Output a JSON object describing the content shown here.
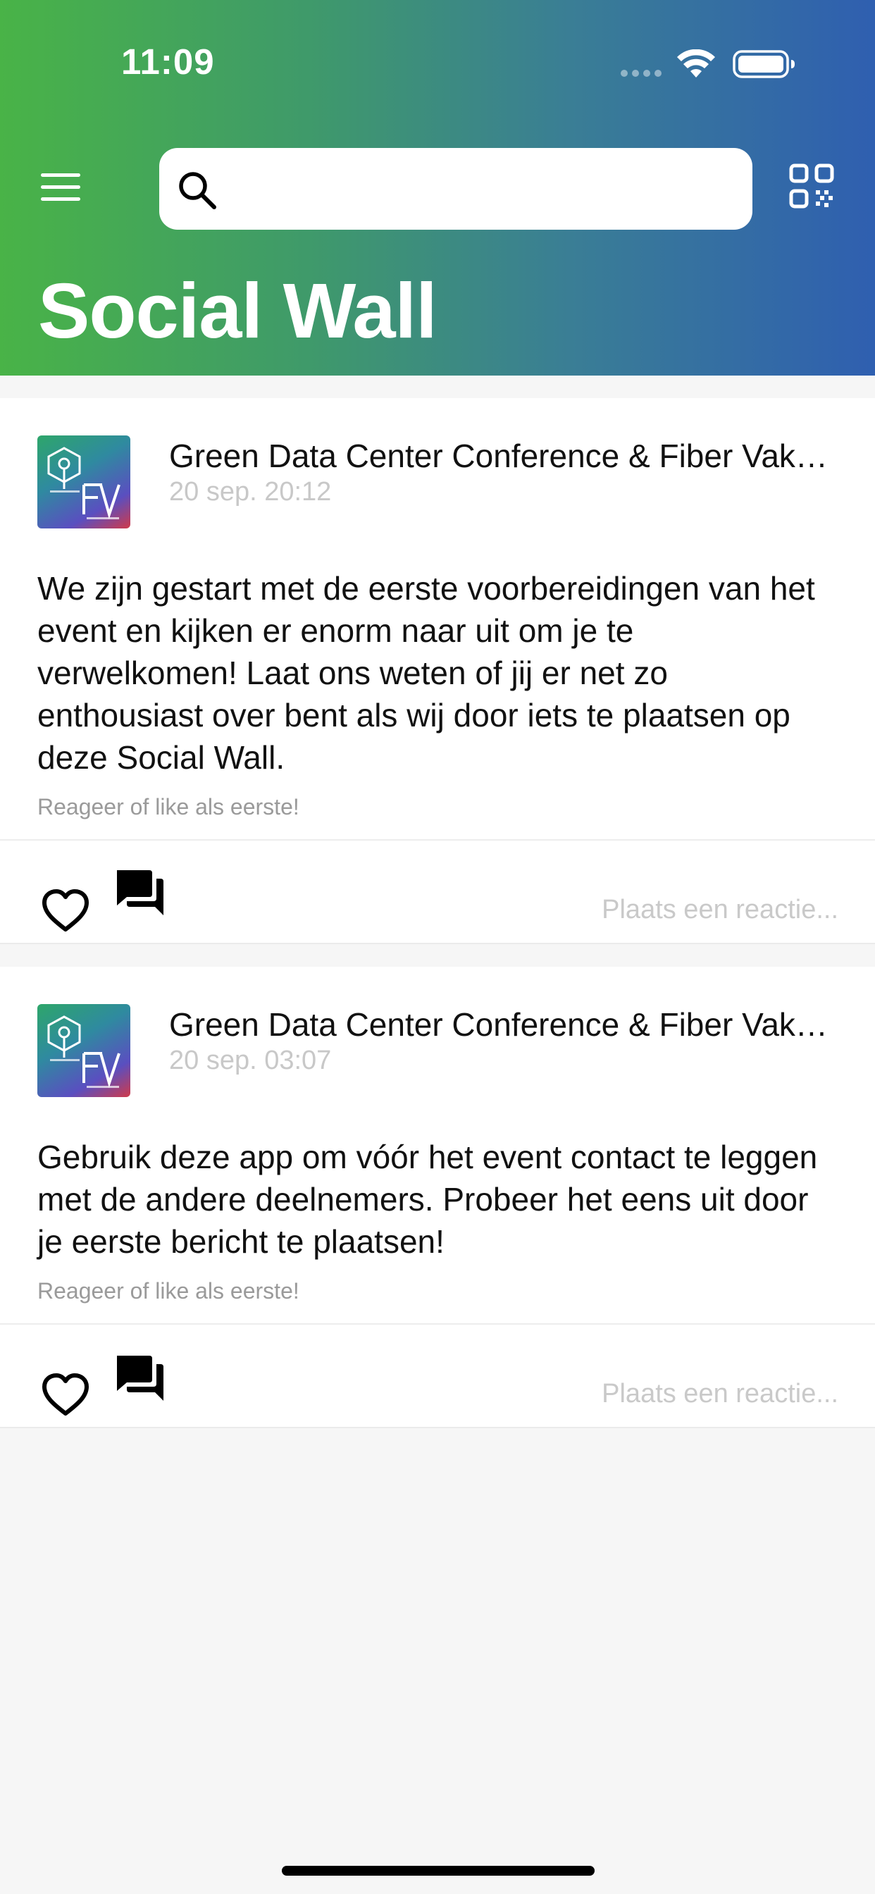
{
  "status_bar": {
    "time": "11:09"
  },
  "header": {
    "title": "Social Wall",
    "search_placeholder": ""
  },
  "icons": {
    "menu": "hamburger-menu-icon",
    "search": "search-icon",
    "qr": "qr-code-icon",
    "like": "heart-outline-icon",
    "comment": "chat-bubbles-icon"
  },
  "colors": {
    "gradient_start": "#49b347",
    "gradient_end": "#2f5fb0",
    "hint": "#9a9a9a",
    "timestamp": "#c8c8c8"
  },
  "posts": [
    {
      "author": "Green Data Center Conference & Fiber Vakdag",
      "time": "20 sep. 20:12",
      "body": "We zijn gestart met de eerste voorbereidingen van het event en kijken er enorm naar uit om je te verwelkomen! Laat ons weten of jij er net zo enthousiast over bent als wij door iets te plaatsen op deze Social Wall.",
      "hint": "Reageer of like als eerste!",
      "reply_placeholder": "Plaats een reactie..."
    },
    {
      "author": "Green Data Center Conference & Fiber Vakdag",
      "time": "20 sep. 03:07",
      "body": "Gebruik deze app om vóór het event contact te leggen met de andere deelnemers. Probeer het eens uit door je eerste bericht te plaatsen!",
      "hint": "Reageer of like als eerste!",
      "reply_placeholder": "Plaats een reactie..."
    }
  ]
}
